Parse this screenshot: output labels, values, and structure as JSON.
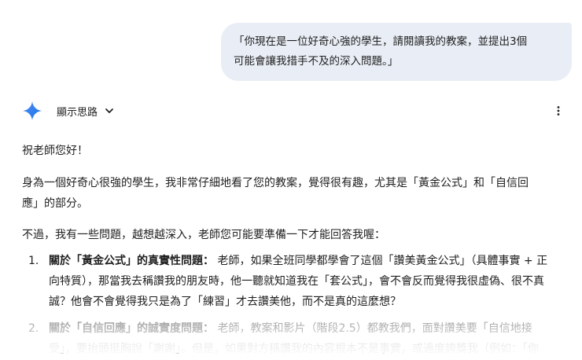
{
  "user_message": {
    "line1": "「你現在是一位好奇心強的學生，請閱讀我的教案，並提出3個",
    "line2": "可能會讓我措手不及的深入問題。」"
  },
  "response": {
    "thinking_toggle_label": "顯示思路",
    "greeting": "祝老師您好！",
    "intro_line1": "身為一個好奇心很強的學生，我非常仔細地看了您的教案，覺得很有趣，尤其是「黃金公式」和「自信回",
    "intro_line2": "應」的部分。",
    "lead_in": "不過，我有一些問題，越想越深入，老師您可能要準備一下才能回答我喔：",
    "questions": [
      {
        "number": "1.",
        "title": "關於「黃金公式」的真實性問題：",
        "line1_rest": " 老師，如果全班同學都學會了這個「讚美黃金公式」（具體事實 + 正",
        "line2": "向特質），那當我去稱讚我的朋友時，他一聽就知道我在「套公式」，會不會反而覺得我很虛偽、很不真",
        "line3": "誠？他會不會覺得我只是為了「練習」才去讚美他，而不是真的這麼想？"
      },
      {
        "number": "2.",
        "title": "關於「自信回應」的誠實度問題：",
        "line1_rest": " 老師，教案和影片（階段2.5）都教我們，面對讚美要「自信地接",
        "line2": "受」，要抬頭挺胸說「謝謝」。但是，如果對方稱讚我的內容根本不是事實，或過度誇獎我（例如：「你"
      }
    ]
  },
  "icons": {
    "assistant": "gemini-sparkle-icon",
    "toggle": "chevron-down-icon",
    "menu": "more-vert-icon"
  },
  "colors": {
    "user_bubble_bg": "#e9eef6",
    "text": "#1f1f1f",
    "sparkle_top": "#4c8df6",
    "sparkle_bottom": "#1a73e8"
  }
}
